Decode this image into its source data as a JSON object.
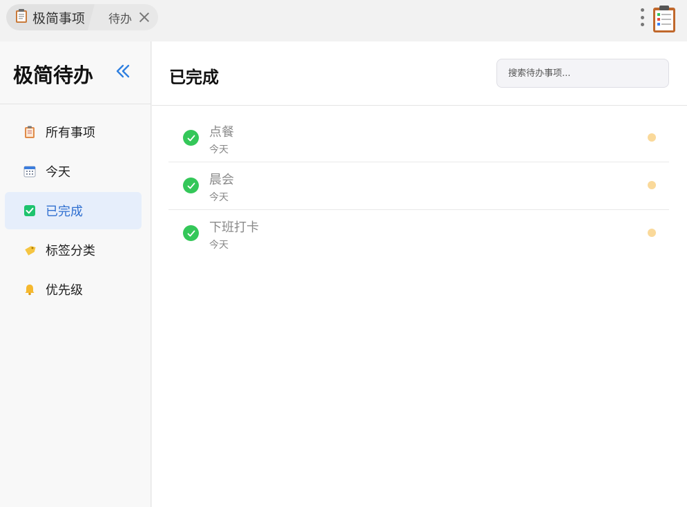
{
  "topbar": {
    "breadcrumb_main": "极简事项",
    "breadcrumb_sub": "待办",
    "breadcrumb_icon": "clipboard-icon",
    "menu_icon": "more-vertical-icon",
    "app_icon": "clipboard-checklist-icon"
  },
  "sidebar": {
    "title": "极简待办",
    "collapse_icon": "double-chevron-left-icon",
    "items": [
      {
        "label": "所有事项",
        "icon": "clipboard-icon",
        "active": false
      },
      {
        "label": "今天",
        "icon": "calendar-icon",
        "active": false
      },
      {
        "label": "已完成",
        "icon": "checkbox-icon",
        "active": true
      },
      {
        "label": "标签分类",
        "icon": "tag-icon",
        "active": false
      },
      {
        "label": "优先级",
        "icon": "bell-icon",
        "active": false
      }
    ]
  },
  "main": {
    "title": "已完成",
    "search_placeholder": "搜索待办事项..."
  },
  "todos": [
    {
      "title": "点餐",
      "date": "今天",
      "done": true,
      "priority_color": "#fad99a"
    },
    {
      "title": "晨会",
      "date": "今天",
      "done": true,
      "priority_color": "#fad99a"
    },
    {
      "title": "下班打卡",
      "date": "今天",
      "done": true,
      "priority_color": "#fad99a"
    }
  ],
  "colors": {
    "accent": "#2f6fd0",
    "done_green": "#34c759",
    "active_bg": "#e6eefb"
  }
}
